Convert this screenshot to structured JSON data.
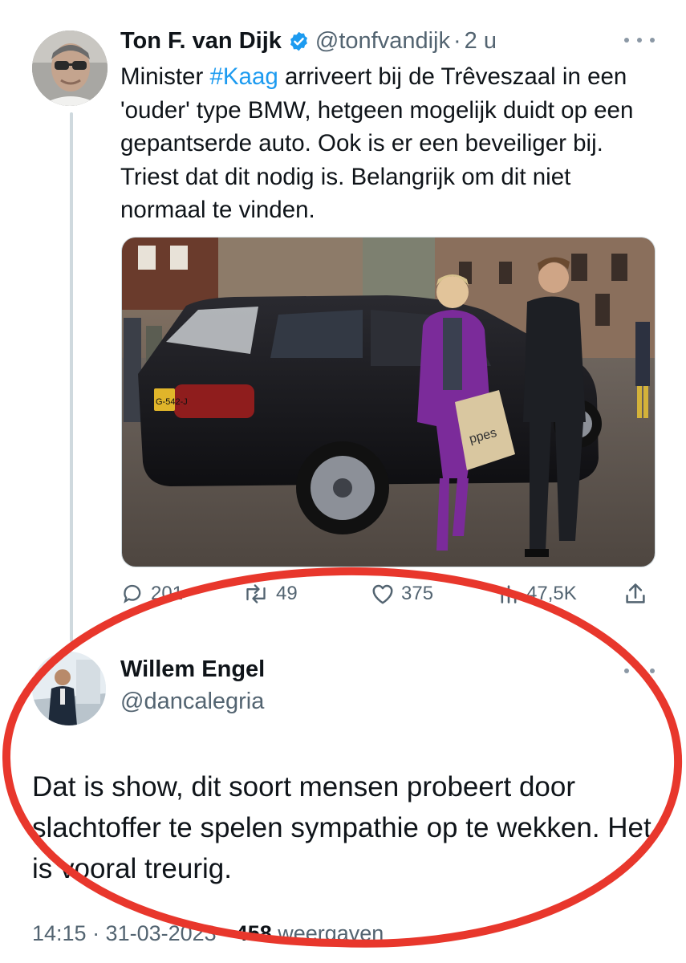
{
  "tweet": {
    "author_name": "Ton F. van Dijk",
    "author_handle": "@tonfvandijk",
    "dot": "·",
    "time": "2 u",
    "text_before": "Minister ",
    "hashtag": "#Kaag",
    "text_after": " arriveert bij de Trêveszaal in een 'ouder' type BMW, hetgeen mogelijk duidt op een gepantserde auto. Ook is er een beveiliger bij. Triest dat dit nodig is. Belangrijk om dit niet normaal te vinden.",
    "license_plate": "G-542-J",
    "bag_text": "ppes"
  },
  "actions": {
    "replies": "201",
    "retweets": "49",
    "likes": "375",
    "views": "47,5K"
  },
  "reply": {
    "author_name": "Willem Engel",
    "author_handle": "@dancalegria",
    "text": "Dat is show, dit soort mensen probeert door slachtoffer te spelen sympathie op te wekken. Het is vooral treurig.",
    "timestamp": "14:15 · 31-03-2023 · ",
    "views_count": "458",
    "views_label": " weergaven"
  },
  "colors": {
    "accent": "#1d9bf0",
    "text": "#0f1419",
    "secondary": "#536471",
    "annotation": "#e8372c"
  }
}
